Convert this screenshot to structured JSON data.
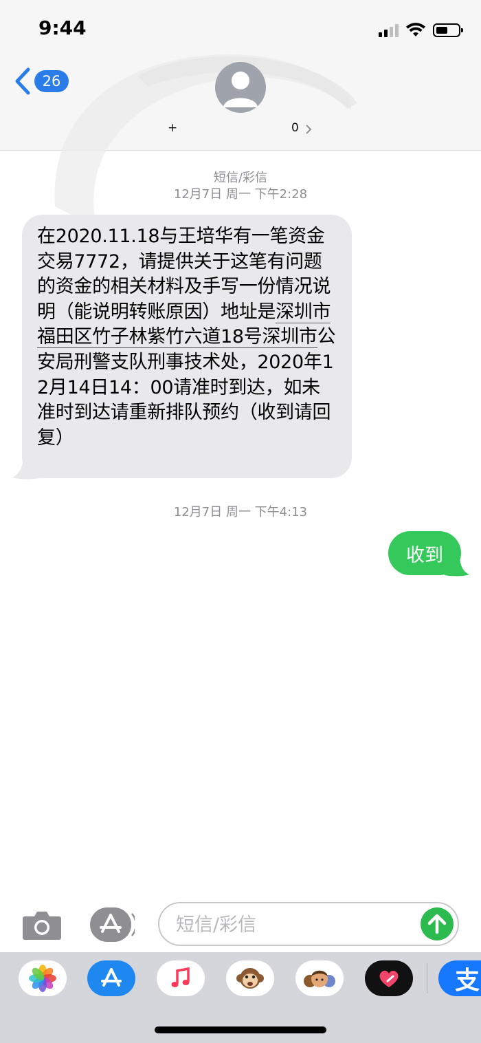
{
  "status_bar": {
    "time": "9:44"
  },
  "header": {
    "back_badge_count": "26",
    "contact_prefix": "+",
    "contact_suffix": "0",
    "contact_chevron": "›"
  },
  "conversation": {
    "service_label": "短信/彩信",
    "messages": [
      {
        "direction": "incoming",
        "timestamp": "12月7日 周一 下午2:28",
        "text_before_link": "在2020.11.18与王培华有一笔资金交易7772，请提供关于这笔有问题的资金的相关材料及手写一份情况说明（能说明转账原因）地址是",
        "link_text": "深圳市福田区竹子林紫竹六道18号深圳市",
        "text_after_link": "公安局刑警支队刑事技术处，2020年12月14日14：00请准时到达，如未准时到达请重新排队预约（收到请回复）"
      },
      {
        "direction": "outgoing",
        "timestamp": "12月7日 周一 下午4:13",
        "text": "收到"
      }
    ]
  },
  "input_bar": {
    "placeholder": "短信/彩信",
    "value": ""
  },
  "app_drawer": {
    "apps": [
      {
        "icon": "photos-icon"
      },
      {
        "icon": "app-store-icon"
      },
      {
        "icon": "music-icon"
      },
      {
        "icon": "animoji-icon"
      },
      {
        "icon": "memoji-stickers-icon"
      },
      {
        "icon": "digital-touch-icon"
      },
      {
        "icon": "alipay-icon",
        "label": "支"
      }
    ]
  },
  "colors": {
    "incoming_bubble": "#e9e9eb",
    "outgoing_bubble": "#35c85a",
    "accent_blue": "#2a7de8",
    "send_button": "#2dbb4f"
  }
}
